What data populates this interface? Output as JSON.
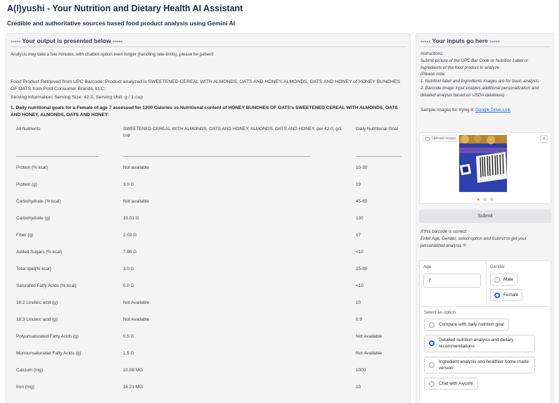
{
  "app": {
    "title": "A(I)yushi - Your Nutrition and Dietary Health AI Assistant",
    "subtitle": "Credible and authoritative sources based food product analysis using Gemini AI"
  },
  "output": {
    "header": "----- Your output is presented below -----",
    "note": "Analysis may take a few minutes..with chatbot option even longer (handling rate-limits), please be patient!",
    "product_line": "Food Product Retrieved from UPC Barcode: Product analyzed is SWEETENED CEREAL WITH ALMONDS, OATS AND HONEY, ALMONDS, OATS AND HONEY of HONEY BUNCHES OF OATS from Post Consumer Brands, LLC:",
    "serving_line": "Serving information: Serving Size: 42.0, Serving Unit: g / 1 cup",
    "goals_heading": "1. Daily nutritional goals for a Female of age 7 assessed for 1200 Calories vs Nutritional content of HONEY BUNCHES OF OATS's SWEETENED CEREAL WITH ALMONDS, OATS AND HONEY, ALMONDS, OATS AND HONEY:",
    "table": {
      "headers": [
        "All Nutrients",
        "SWEETENED CEREAL WITH ALMONDS, OATS AND HONEY, ALMONDS, OATS AND HONEY, per 42.0, g/1 cup",
        "Daily Nutritional Goal"
      ],
      "separator": [
        "______________________________________",
        "_______________________________________________________________________________________",
        "_____________________"
      ],
      "rows": [
        [
          "Protein (% kcal)",
          "Not available",
          "10-30"
        ],
        [
          "Protein (g)",
          "3.0 G",
          "19"
        ],
        [
          "Carbohydrate (% kcal)",
          "Not available",
          "45-65"
        ],
        [
          "Carbohydrate (g)",
          "33.01 G",
          "130"
        ],
        [
          "Fiber (g)",
          "2.02 G",
          "17"
        ],
        [
          "Added Sugars (% kcal)",
          "7.98 G",
          "<10"
        ],
        [
          "Total lipid(% kcal)",
          "3.0 G",
          "25-35"
        ],
        [
          "Saturated Fatty Acids (% kcal)",
          "0.0 G",
          "<10"
        ],
        [
          "18:2 Linoleic acid (g)",
          "Not Available",
          "10"
        ],
        [
          "18:3 Linoleic acid (g)",
          "Not Available",
          "0.9"
        ],
        [
          "Polyunsaturated Fatty Acids (g)",
          "0.5 G",
          "Not Available"
        ],
        [
          "Monounsaturated Fatty Acids (g)",
          "1.5 G",
          "Not Available"
        ],
        [
          "Calcium (mg)",
          "10.08 MG",
          "1000"
        ],
        [
          "Iron (mg)",
          "16.21 MG",
          "10"
        ]
      ]
    }
  },
  "input": {
    "header": "----- Your inputs go here -----",
    "instructions": [
      "Instructions:",
      "Submit picture of the UPC Bar Code or Nutrition Label or Ingredients of the food product to analyze",
      "(Please note:",
      "1. Nutrition label and Ingredients images are for basic analysis",
      "2. Barcode image input enables additional personalization and detailed analysis based on USDA database)"
    ],
    "sample_prefix": "Sample images for trying it: ",
    "sample_link": "Google Drive Link",
    "upload_label": "Upload image",
    "close_glyph": "×",
    "submit_label": "Submit",
    "after_submit": [
      "If this barcode is correct:",
      "Enter Age, Gender, select option and Submit to get your personalized analysis !!!"
    ],
    "age_label": "Age",
    "age_value": "7",
    "gender_label": "Gender",
    "gender_options": [
      {
        "label": "Male",
        "selected": false
      },
      {
        "label": "Female",
        "selected": true
      }
    ],
    "option_label": "Select an option",
    "options": [
      {
        "label": "Compare with daily nutrition goal",
        "selected": false
      },
      {
        "label": "Detailed nutrition analysis and dietary recommendations",
        "selected": true
      },
      {
        "label": "Ingredient analysis and healthier home-made version",
        "selected": false
      },
      {
        "label": "Chat with Aiyushi",
        "selected": false
      }
    ]
  },
  "colors": {
    "accent": "#2563eb",
    "panel_bg": "#f4f4f5",
    "link": "#2563eb"
  }
}
